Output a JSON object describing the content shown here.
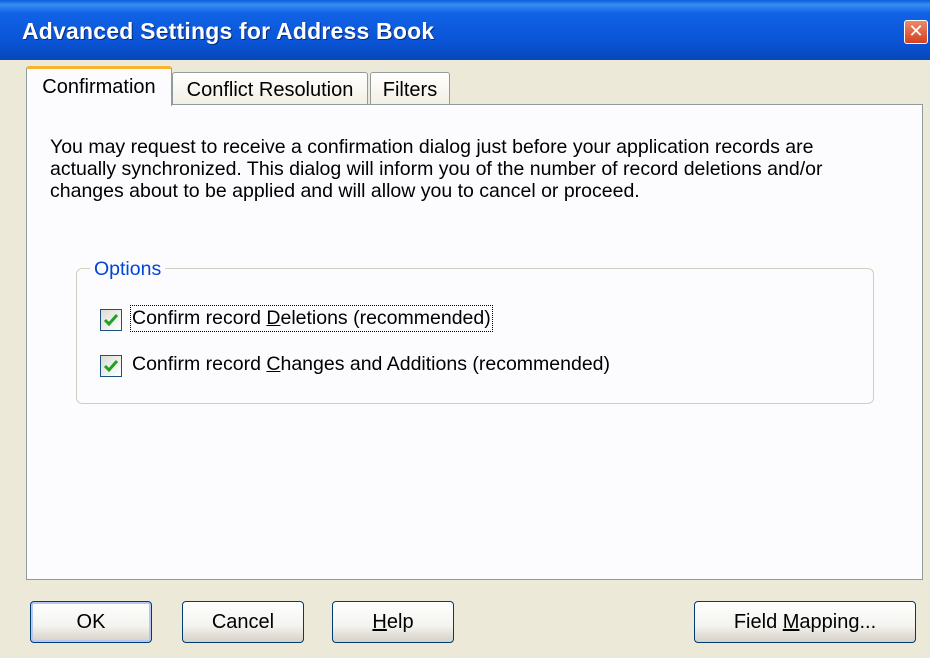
{
  "window": {
    "title": "Advanced Settings for Address Book",
    "close_glyph": "✕"
  },
  "tabs": [
    {
      "label": "Confirmation",
      "active": true
    },
    {
      "label": "Conflict Resolution",
      "active": false
    },
    {
      "label": "Filters",
      "active": false
    }
  ],
  "confirmation": {
    "description": "You may request to receive a confirmation dialog just before your application records are actually synchronized.  This dialog will inform you of the number of record deletions and/or changes about to be applied and will allow you to cancel or proceed.",
    "options_title": "Options",
    "options": [
      {
        "pre": "Confirm record ",
        "mnemonic": "D",
        "post": "eletions (recommended)",
        "checked": true
      },
      {
        "pre": "Confirm record ",
        "mnemonic": "C",
        "post": "hanges and Additions (recommended)",
        "checked": true
      }
    ]
  },
  "buttons": {
    "ok": "OK",
    "cancel": "Cancel",
    "help_mnemonic": "H",
    "help_rest": "elp",
    "field_mapping_pre": "Field ",
    "field_mapping_mnemonic": "M",
    "field_mapping_post": "apping..."
  },
  "colors": {
    "title_bar": "#0a54d6",
    "dialog_bg": "#ece9d8",
    "check_mark": "#21a121",
    "active_tab_highlight": "#f8b230",
    "group_title": "#0046d5"
  },
  "icons": {
    "close": "close-icon",
    "check": "check-icon"
  }
}
